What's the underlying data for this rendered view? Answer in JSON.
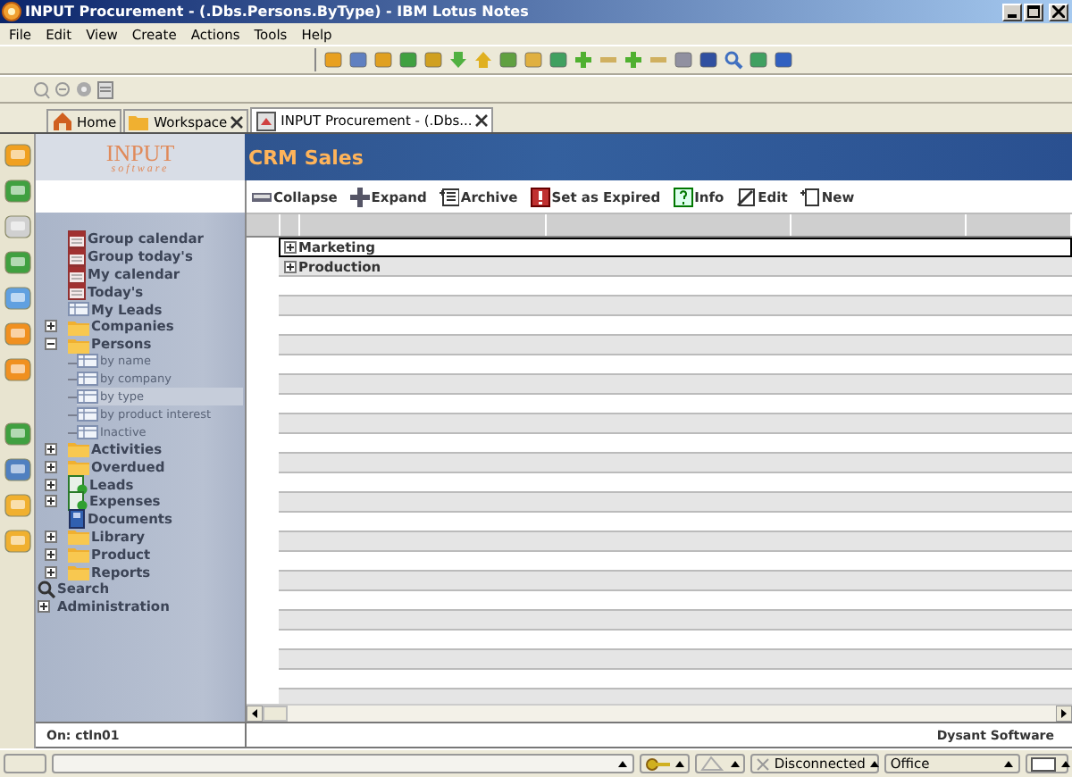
{
  "window": {
    "title": "INPUT Procurement - (.Dbs.Persons.ByType) - IBM Lotus Notes"
  },
  "menu": [
    "File",
    "Edit",
    "View",
    "Create",
    "Actions",
    "Tools",
    "Help"
  ],
  "tabs": [
    {
      "label": "Home",
      "selected": false,
      "closable": false
    },
    {
      "label": "Workspace",
      "selected": false,
      "closable": true
    },
    {
      "label": "INPUT Procurement - (.Dbs...",
      "selected": true,
      "closable": true
    }
  ],
  "banner": {
    "logo": "INPUT",
    "logo_subtitle": "software",
    "app_title": "CRM Sales"
  },
  "actions": [
    "Collapse",
    "Expand",
    "Archive",
    "Set as Expired",
    "Info",
    "Edit",
    "New"
  ],
  "nav": [
    {
      "label": "Group calendar",
      "kind": "calendar",
      "selected": false
    },
    {
      "label": "Group today's",
      "kind": "calendar",
      "selected": false
    },
    {
      "label": "My calendar",
      "kind": "calendar",
      "selected": false
    },
    {
      "label": "Today's",
      "kind": "calendar",
      "selected": false
    },
    {
      "label": "My Leads",
      "kind": "view",
      "selected": false
    },
    {
      "label": "Companies",
      "kind": "folder",
      "expanded": false,
      "selected": false
    },
    {
      "label": "Persons",
      "kind": "folder",
      "expanded": true,
      "selected": false,
      "children": [
        {
          "label": "by name",
          "kind": "view",
          "selected": false
        },
        {
          "label": "by company",
          "kind": "view",
          "selected": false
        },
        {
          "label": "by type",
          "kind": "view",
          "selected": true
        },
        {
          "label": "by product interest",
          "kind": "view",
          "selected": false
        },
        {
          "label": "Inactive",
          "kind": "view",
          "selected": false
        }
      ]
    },
    {
      "label": "Activities",
      "kind": "folder",
      "expanded": false,
      "selected": false
    },
    {
      "label": "Overdued",
      "kind": "folder",
      "expanded": false,
      "selected": false
    },
    {
      "label": "Leads",
      "kind": "form",
      "expanded": false,
      "selected": false
    },
    {
      "label": "Expenses",
      "kind": "form",
      "expanded": false,
      "selected": false
    },
    {
      "label": "Documents",
      "kind": "book",
      "selected": false
    },
    {
      "label": "Library",
      "kind": "folder",
      "expanded": false,
      "selected": false
    },
    {
      "label": "Product",
      "kind": "folder",
      "expanded": false,
      "selected": false
    },
    {
      "label": "Reports",
      "kind": "folder",
      "expanded": false,
      "selected": false
    },
    {
      "label": "Search",
      "kind": "search",
      "selected": false
    },
    {
      "label": "Administration",
      "kind": "section",
      "expanded": false,
      "selected": false
    }
  ],
  "view": {
    "rows": [
      {
        "label": "Marketing",
        "expanded": false,
        "selected": true
      },
      {
        "label": "Production",
        "expanded": false,
        "selected": false
      }
    ]
  },
  "footer": {
    "left": "On: ctln01",
    "right": "Dysant Software"
  },
  "status_bar": {
    "connection": "Disconnected",
    "location": "Office"
  }
}
